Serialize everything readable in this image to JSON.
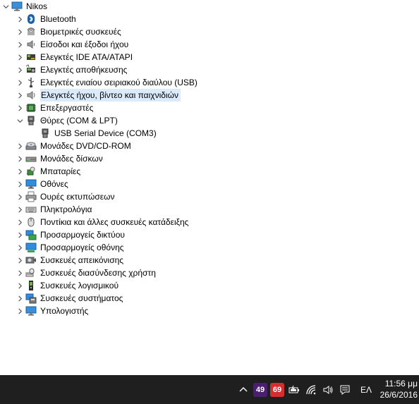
{
  "tree": {
    "root_label": "Nikos",
    "categories": [
      {
        "label": "Bluetooth",
        "icon": "bluetooth-icon"
      },
      {
        "label": "Βιομετρικές συσκευές",
        "icon": "fingerprint-icon"
      },
      {
        "label": "Είσοδοι και έξοδοι ήχου",
        "icon": "speaker-icon"
      },
      {
        "label": "Ελεγκτές IDE ATA/ATAPI",
        "icon": "ide-controller-icon"
      },
      {
        "label": "Ελεγκτές αποθήκευσης",
        "icon": "storage-controller-icon"
      },
      {
        "label": "Ελεγκτές ενιαίου σειριακού διαύλου (USB)",
        "icon": "usb-icon"
      },
      {
        "label": "Ελεγκτές ήχου, βίντεο και παιχνιδιών",
        "icon": "sound-video-icon",
        "selected": true
      },
      {
        "label": "Επεξεργαστές",
        "icon": "processor-icon"
      },
      {
        "label": "Θύρες (COM & LPT)",
        "icon": "port-icon",
        "expanded": true,
        "children": [
          {
            "label": "USB Serial Device (COM3)",
            "icon": "port-icon"
          }
        ]
      },
      {
        "label": "Μονάδες DVD/CD-ROM",
        "icon": "dvd-drive-icon"
      },
      {
        "label": "Μονάδες δίσκων",
        "icon": "disk-drive-icon"
      },
      {
        "label": "Μπαταρίες",
        "icon": "battery-icon"
      },
      {
        "label": "Οθόνες",
        "icon": "monitor-icon"
      },
      {
        "label": "Ουρές εκτυπώσεων",
        "icon": "printer-icon"
      },
      {
        "label": "Πληκτρολόγια",
        "icon": "keyboard-icon"
      },
      {
        "label": "Ποντίκια και άλλες συσκευές κατάδειξης",
        "icon": "mouse-icon"
      },
      {
        "label": "Προσαρμογείς δικτύου",
        "icon": "network-adapter-icon"
      },
      {
        "label": "Προσαρμογείς οθόνης",
        "icon": "display-adapter-icon"
      },
      {
        "label": "Συσκευές απεικόνισης",
        "icon": "camera-icon"
      },
      {
        "label": "Συσκευές διασύνδεσης χρήστη",
        "icon": "hid-icon"
      },
      {
        "label": "Συσκευές λογισμικού",
        "icon": "software-device-icon"
      },
      {
        "label": "Συσκευές συστήματος",
        "icon": "system-device-icon"
      },
      {
        "label": "Υπολογιστής",
        "icon": "computer-icon"
      }
    ]
  },
  "taskbar": {
    "badge_purple": "49",
    "badge_red": "69",
    "language": "ΕΛ",
    "time": "11:56 μμ",
    "date": "26/6/2016",
    "colors": {
      "badge_purple": "#4b1f6f",
      "badge_red": "#d32f2f",
      "background": "#1f1f1f"
    }
  }
}
